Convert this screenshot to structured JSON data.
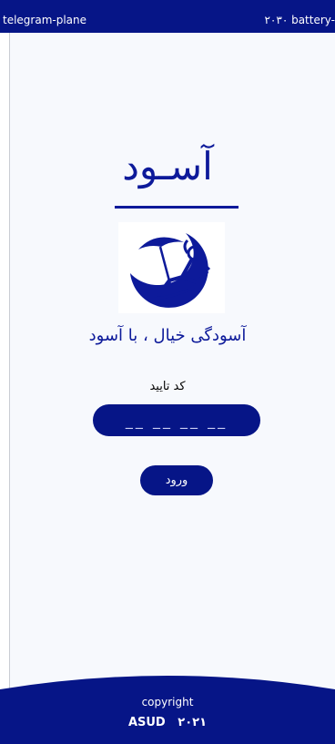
{
  "status_bar": {
    "left_text": "telegram-plane",
    "right_text": "۲۰۳۰ battery-"
  },
  "main": {
    "title": "آسـود",
    "tagline": "آسودگی خیال ، با آسود",
    "code_label": "کد تایید",
    "code_placeholder": "__ __ __ __",
    "login_label": "ورود"
  },
  "footer": {
    "copyright": "copyright",
    "brand": "ASUD   ۲۰۲۱"
  },
  "colors": {
    "primary": "#061587",
    "accent_text": "#0d1a9a",
    "background": "#f7f9fd"
  },
  "icons": {
    "logo": "relaxing-person-lounge-chair-logo"
  }
}
